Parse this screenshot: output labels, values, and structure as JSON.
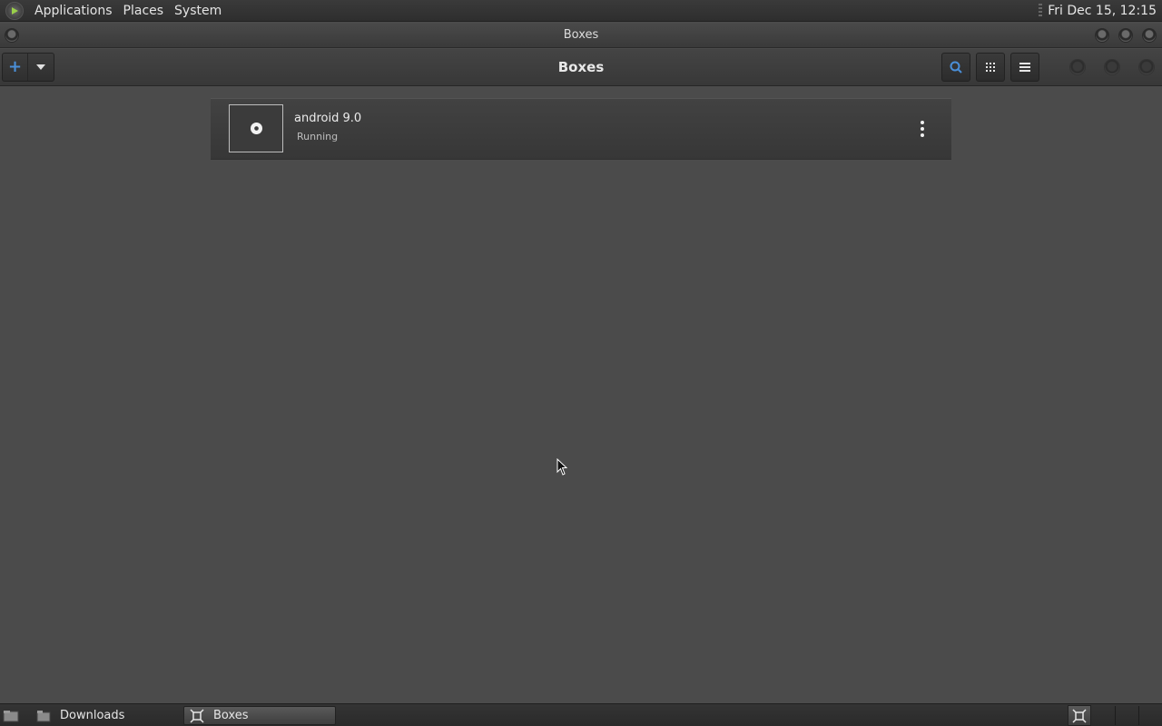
{
  "top_panel": {
    "menus": [
      "Applications",
      "Places",
      "System"
    ],
    "clock": "Fri Dec 15, 12:15"
  },
  "window": {
    "title": "Boxes"
  },
  "header": {
    "title": "Boxes",
    "new_button_icon": "plus-icon",
    "accent": "#4a8fd8"
  },
  "boxes": [
    {
      "name": "android 9.0",
      "status": "Running",
      "icon": "disc-icon"
    }
  ],
  "taskbar": {
    "tasks": [
      {
        "label": "Downloads",
        "icon": "folder-icon",
        "active": false
      },
      {
        "label": "Boxes",
        "icon": "boxes-icon",
        "active": true
      }
    ]
  }
}
